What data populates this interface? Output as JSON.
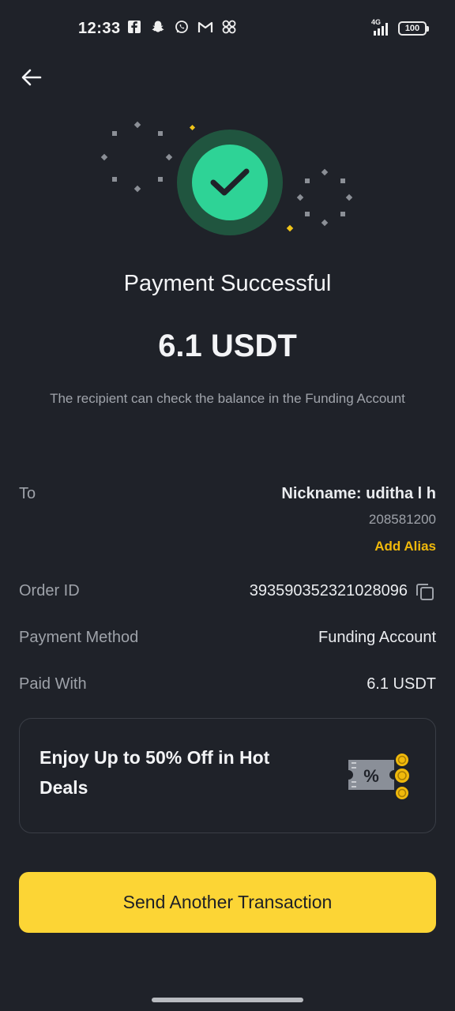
{
  "status_bar": {
    "time": "12:33",
    "network": "4G",
    "battery": "100",
    "notification_icons": [
      "facebook-icon",
      "snapchat-icon",
      "whatsapp-icon",
      "gmail-icon",
      "app-grid-icon"
    ]
  },
  "colors": {
    "background": "#1f2229",
    "success": "#2ed396",
    "accent": "#fcd535",
    "link": "#f0b90b"
  },
  "header": {
    "back_icon": "arrow-left-icon"
  },
  "result": {
    "title": "Payment Successful",
    "amount": "6.1 USDT",
    "note": "The recipient can check the balance in the Funding Account"
  },
  "details": {
    "to_label": "To",
    "nickname": "Nickname: uditha l h",
    "user_id": "208581200",
    "add_alias": "Add Alias",
    "order_label": "Order ID",
    "order_id": "393590352321028096",
    "method_label": "Payment Method",
    "method_value": "Funding Account",
    "paid_label": "Paid With",
    "paid_value": "6.1 USDT"
  },
  "promo": {
    "text": "Enjoy Up to 50% Off in Hot Deals",
    "icon": "coupon-icon"
  },
  "cta": {
    "label": "Send Another Transaction"
  }
}
